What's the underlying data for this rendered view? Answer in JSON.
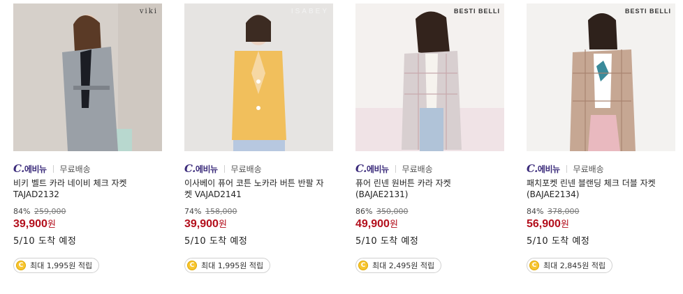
{
  "products": [
    {
      "brand_logo": "viki",
      "store": "에비뉴",
      "shipping": "무료배송",
      "title": "비키 벨트 카라 네이비 체크 자켓 TAJAD2132",
      "discount": "84%",
      "original_price": "259,000",
      "price": "39,900",
      "currency": "원",
      "arrival": "5/10 도착 예정",
      "points": "최대 1,995원 적립"
    },
    {
      "brand_logo": "ISABEY",
      "store": "에비뉴",
      "shipping": "무료배송",
      "title": "이사베이 퓨어 코튼 노카라 버튼 반팔 자켓 VAJAD2141",
      "discount": "74%",
      "original_price": "158,000",
      "price": "39,900",
      "currency": "원",
      "arrival": "5/10 도착 예정",
      "points": "최대 1,995원 적립"
    },
    {
      "brand_logo": "BESTI BELLI",
      "store": "에비뉴",
      "shipping": "무료배송",
      "title": "퓨어 린넨 원버튼 카라 자켓 (BAJAE2131)",
      "discount": "86%",
      "original_price": "350,000",
      "price": "49,900",
      "currency": "원",
      "arrival": "5/10 도착 예정",
      "points": "최대 2,495원 적립"
    },
    {
      "brand_logo": "BESTI BELLI",
      "store": "에비뉴",
      "shipping": "무료배송",
      "title": "패치포켓 린넨 블랜딩 체크 더블 자켓 (BAJAE2134)",
      "discount": "84%",
      "original_price": "378,000",
      "price": "56,900",
      "currency": "원",
      "arrival": "5/10 도착 예정",
      "points": "최대 2,845원 적립"
    }
  ],
  "colors": {
    "price": "#b30f1c",
    "store_mark": "#3a2a7a",
    "coin": "#f7c531"
  },
  "icons": {
    "coin": "coin-icon",
    "store": "c-avenue-logo"
  }
}
